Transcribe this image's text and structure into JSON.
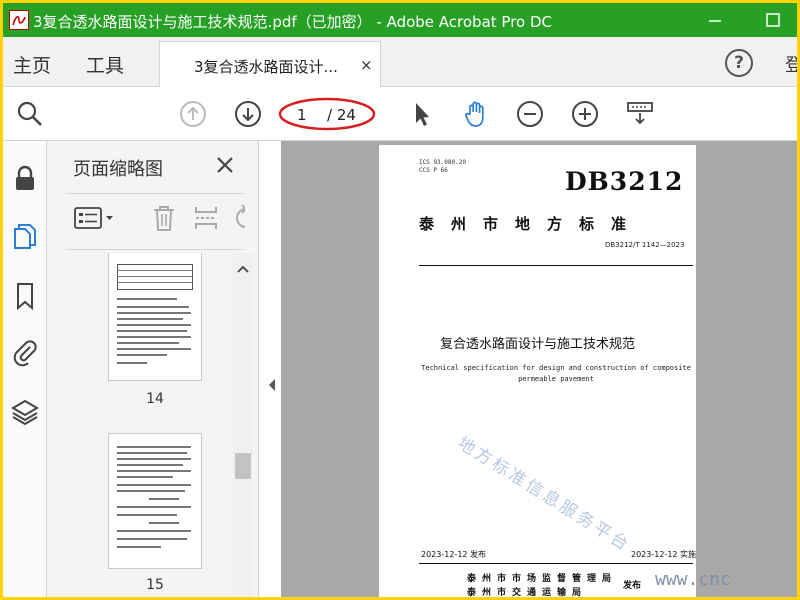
{
  "window": {
    "title": "3复合透水路面设计与施工技术规范.pdf（已加密） - Adobe Acrobat Pro DC",
    "title_bar_color": "#26a126",
    "frame_color": "#ffd200"
  },
  "tabs": {
    "home": "主页",
    "tools": "工具",
    "document": "3复合透水路面设计...",
    "close": "×",
    "help": "?",
    "signin_partial": "登"
  },
  "toolbar": {
    "current_page": "1",
    "total_pages": "/ 24",
    "highlight_color": "#d62020",
    "active_tool": "hand-tool",
    "accent_color": "#2a7fd4"
  },
  "rail": {
    "items": [
      "lock-icon",
      "pages-icon",
      "bookmark-icon",
      "attachment-icon",
      "layers-icon"
    ]
  },
  "thumbnail_panel": {
    "title": "页面缩略图",
    "thumbnails": [
      {
        "page_label": "14"
      },
      {
        "page_label": "15"
      }
    ]
  },
  "document": {
    "ics": "ICS 93.080.20",
    "ccs": "CCS P 66",
    "standard_code": "DB3212",
    "standard_type": "泰州市地方标准",
    "standard_number": "DB3212/T 1142—2023",
    "title_cn": "复合透水路面设计与施工技术规范",
    "title_en_line1": "Technical specification for design and construction of composite",
    "title_en_line2": "permeable pavement",
    "watermark": "地方标准信息服务平台",
    "publish_date": "2023-12-12 发布",
    "implement_date": "2023-12-12 实施",
    "issuer_line1": "泰州市市场监督管理局",
    "issuer_line2": "泰州市交通运输局",
    "issue_word": "发布",
    "site_watermark": "www.cnc"
  }
}
